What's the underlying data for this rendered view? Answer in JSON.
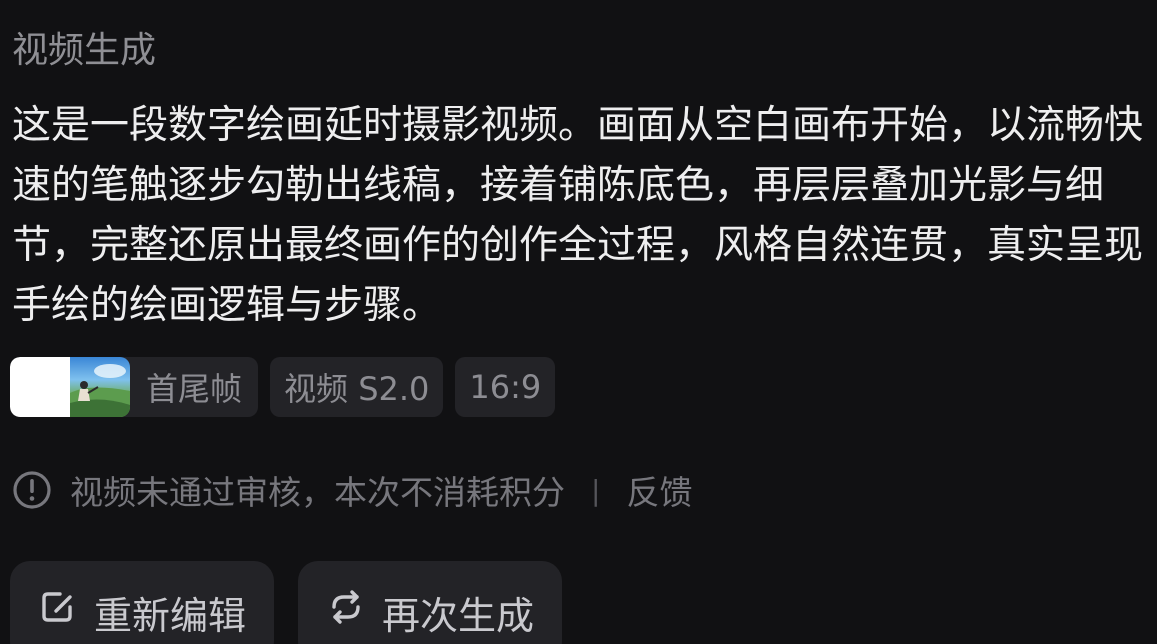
{
  "section": {
    "title": "视频生成"
  },
  "prompt": {
    "text": "这是一段数字绘画延时摄影视频。画面从空白画布开始，以流畅快速的笔触逐步勾勒出线稿，接着铺陈底色，再层层叠加光影与细节，完整还原出最终画作的创作全过程，风格自然连贯，真实呈现手绘的绘画逻辑与步骤。"
  },
  "chips": {
    "frames_label": "首尾帧",
    "model_label": "视频 S2.0",
    "ratio_label": "16:9"
  },
  "notice": {
    "icon": "exclamation-circle-icon",
    "text": "视频未通过审核，本次不消耗积分",
    "separator": "|",
    "feedback_label": "反馈"
  },
  "actions": {
    "edit_label": "重新编辑",
    "edit_icon": "edit-icon",
    "regenerate_label": "再次生成",
    "regenerate_icon": "refresh-icon"
  },
  "colors": {
    "background": "#111113",
    "chip_background": "#232327",
    "text_primary": "#eeeeef",
    "text_secondary": "#8f8f94"
  }
}
